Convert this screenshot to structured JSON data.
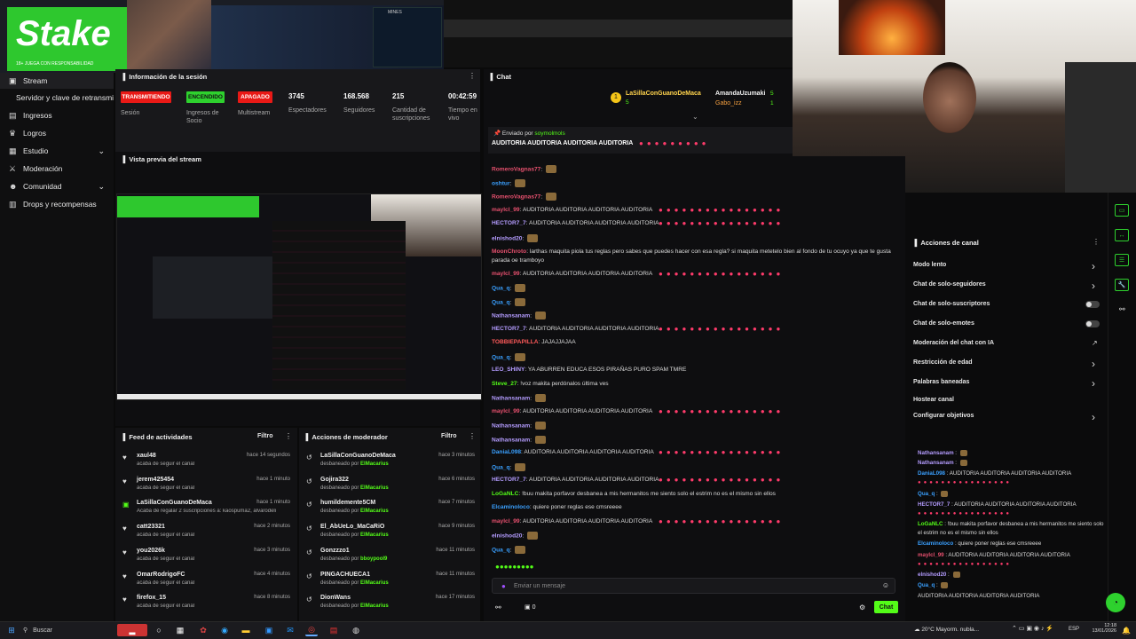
{
  "overlay": {
    "logo": "Stake",
    "logo_sub": "18+ JUEGA CON RESPONSABILIDAD",
    "game_tag": "MINES"
  },
  "session": {
    "title": "Información de la sesión",
    "badges": [
      {
        "label": "TRANSMITIENDO",
        "color": "#e91916",
        "caption": "Sesión"
      },
      {
        "label": "ENCENDIDO",
        "color": "#2ed12e",
        "caption": "Ingresos de Socio"
      },
      {
        "label": "APAGADO",
        "color": "#e91916",
        "caption": "Multistream"
      }
    ],
    "stats": [
      {
        "value": "3745",
        "label": "Espectadores"
      },
      {
        "value": "168.568",
        "label": "Seguidores"
      },
      {
        "value": "215",
        "label": "Cantidad de suscripciones"
      },
      {
        "value": "00:42:59",
        "label": "Tiempo en vivo"
      }
    ]
  },
  "sidebar": {
    "items": [
      {
        "label": "Stream",
        "icon": "stream-icon"
      },
      {
        "label": "Servidor y clave de retransmisión",
        "icon": ""
      },
      {
        "label": "Ingresos",
        "icon": "money-icon"
      },
      {
        "label": "Logros",
        "icon": "trophy-icon"
      },
      {
        "label": "Estudio",
        "icon": "studio-icon"
      },
      {
        "label": "Moderación",
        "icon": "sword-icon"
      },
      {
        "label": "Comunidad",
        "icon": "community-icon"
      },
      {
        "label": "Drops y recompensas",
        "icon": "gift-icon"
      }
    ]
  },
  "preview": {
    "title": "Vista previa del stream"
  },
  "chat": {
    "title": "Chat",
    "top_users": [
      {
        "name": "LaSillaConGuanoDeMaca",
        "count": "5"
      },
      {
        "name": "AmandaUzumaki",
        "count": "5"
      },
      {
        "name": "Gabo_izz",
        "count": "1"
      }
    ],
    "pinned_by_label": "Enviado por",
    "pinned_by_user": "soymolmols",
    "pinned_text": "AUDITORIA AUDITORIA AUDITORIA AUDITORIA",
    "input_placeholder": "Enviar un mensaje",
    "send_label": "Chat",
    "counter": "0",
    "messages": [
      {
        "user": "RomeroVagnas77",
        "color": "#e6506e",
        "text": ""
      },
      {
        "user": "oshtur",
        "color": "#3aa0ff",
        "text": ""
      },
      {
        "user": "RomeroVagnas77",
        "color": "#e6506e",
        "text": ""
      },
      {
        "user": "maylcl_99",
        "color": "#e6506e",
        "text": "AUDITORIA AUDITORIA AUDITORIA AUDITORIA"
      },
      {
        "user": "HECTOR7_7",
        "color": "#b49cff",
        "text": "AUDITORIA AUDITORIA AUDITORIA AUDITORIA"
      },
      {
        "user": "elnishod20",
        "color": "#b49cff",
        "text": ""
      },
      {
        "user": "MoonChroto",
        "color": "#e6506e",
        "text": "larthas maquita piola tus reglas pero sabes que puedes hacer con esa regla? si maquita metetelo bien al fondo de tu ocuyo ya que te gusta parada oe tramboyo"
      },
      {
        "user": "maylcl_99",
        "color": "#e6506e",
        "text": "AUDITORIA AUDITORIA AUDITORIA AUDITORIA"
      },
      {
        "user": "Qua_q",
        "color": "#3aa0ff",
        "text": ""
      },
      {
        "user": "Qua_q",
        "color": "#3aa0ff",
        "text": ""
      },
      {
        "user": "Nathansanam",
        "color": "#b49cff",
        "text": ""
      },
      {
        "user": "HECTOR7_7",
        "color": "#b49cff",
        "text": "AUDITORIA AUDITORIA AUDITORIA AUDITORIA"
      },
      {
        "user": "TOBBIEPAPILLA",
        "color": "#ff5a5a",
        "text": "JAJAJJAJAA"
      },
      {
        "user": "Qua_q",
        "color": "#3aa0ff",
        "text": ""
      },
      {
        "user": "LEO_SHINY",
        "color": "#b49cff",
        "text": "YA ABURREN EDUCA ESOS PIRAÑAS PURO SPAM TMRE"
      },
      {
        "user": "Steve_27",
        "color": "#53fc18",
        "text": "!voz makita perdónalos última ves"
      },
      {
        "user": "Nathansanam",
        "color": "#b49cff",
        "text": ""
      },
      {
        "user": "maylcl_99",
        "color": "#e6506e",
        "text": "AUDITORIA AUDITORIA AUDITORIA AUDITORIA"
      },
      {
        "user": "Nathansanam",
        "color": "#b49cff",
        "text": ""
      },
      {
        "user": "Nathansanam",
        "color": "#b49cff",
        "text": ""
      },
      {
        "user": "DaniaL098",
        "color": "#3aa0ff",
        "text": "AUDITORIA AUDITORIA AUDITORIA AUDITORIA"
      },
      {
        "user": "Qua_q",
        "color": "#3aa0ff",
        "text": ""
      },
      {
        "user": "HECTOR7_7",
        "color": "#b49cff",
        "text": "AUDITORIA AUDITORIA AUDITORIA AUDITORIA"
      },
      {
        "user": "LoGaNLC",
        "color": "#53fc18",
        "text": "!buu makita porfavor desbanea a mis hermanitos me siento solo el estrim no es el mismo sin ellos"
      },
      {
        "user": "Elcaminoloco",
        "color": "#3aa0ff",
        "text": "quiere poner reglas ese cmsreeee"
      },
      {
        "user": "maylcl_99",
        "color": "#e6506e",
        "text": "AUDITORIA AUDITORIA AUDITORIA AUDITORIA"
      },
      {
        "user": "elnishod20",
        "color": "#b49cff",
        "text": ""
      },
      {
        "user": "Qua_q",
        "color": "#3aa0ff",
        "text": ""
      }
    ]
  },
  "activity": {
    "title": "Feed de actividades",
    "filter": "Filtro",
    "items": [
      {
        "name": "xaul48",
        "sub": "acaba de seguir el canal",
        "time": "hace 14 segundos",
        "icon": "heart-icon"
      },
      {
        "name": "jerem425454",
        "sub": "acaba de seguir el canal",
        "time": "hace 1 minuto",
        "icon": "heart-icon"
      },
      {
        "name": "LaSillaConGuanoDeMaca",
        "sub": "Acaba de regalar 2 suscripciones a: kaospuma2, alvarodeli",
        "time": "hace 1 minuto",
        "icon": "gift-icon"
      },
      {
        "name": "catt23321",
        "sub": "acaba de seguir el canal",
        "time": "hace 2 minutos",
        "icon": "heart-icon"
      },
      {
        "name": "you2026k",
        "sub": "acaba de seguir el canal",
        "time": "hace 3 minutos",
        "icon": "heart-icon"
      },
      {
        "name": "OmarRodrigoFC",
        "sub": "acaba de seguir el canal",
        "time": "hace 4 minutos",
        "icon": "heart-icon"
      },
      {
        "name": "firefox_15",
        "sub": "acaba de seguir el canal",
        "time": "hace 8 minutos",
        "icon": "heart-icon"
      }
    ]
  },
  "modactions": {
    "title": "Acciones de moderador",
    "filter": "Filtro",
    "items": [
      {
        "name": "LaSillaConGuanoDeMaca",
        "sub": "desbaneado por",
        "by": "ElMacarius",
        "time": "hace 3 minutos"
      },
      {
        "name": "Gojira322",
        "sub": "desbaneado por",
        "by": "ElMacarius",
        "time": "hace 6 minutos"
      },
      {
        "name": "humildemente5CM",
        "sub": "desbaneado por",
        "by": "ElMacarius",
        "time": "hace 7 minutos"
      },
      {
        "name": "El_AbUeLo_MaCaRiO",
        "sub": "desbaneado por",
        "by": "ElMacarius",
        "time": "hace 9 minutos"
      },
      {
        "name": "Gonzzzo1",
        "sub": "desbaneado por",
        "by": "bboypool9",
        "time": "hace 11 minutos"
      },
      {
        "name": "PINGACHUECA1",
        "sub": "desbaneado por",
        "by": "ElMacarius",
        "time": "hace 11 minutos"
      },
      {
        "name": "DionWans",
        "sub": "desbaneado por",
        "by": "ElMacarius",
        "time": "hace 17 minutos"
      }
    ]
  },
  "channel_actions": {
    "title": "Acciones de canal",
    "items": [
      {
        "label": "Modo lento",
        "control": "chevron"
      },
      {
        "label": "Chat de solo-seguidores",
        "control": "chevron"
      },
      {
        "label": "Chat de solo-suscriptores",
        "control": "toggle"
      },
      {
        "label": "Chat de solo-emotes",
        "control": "toggle"
      },
      {
        "label": "Moderación del chat con IA",
        "control": "external"
      },
      {
        "label": "Restricción de edad",
        "control": "chevron"
      },
      {
        "label": "Palabras baneadas",
        "control": "chevron"
      },
      {
        "label": "Hostear canal",
        "control": "none"
      },
      {
        "label": "Configurar objetivos",
        "control": "chevron"
      }
    ]
  },
  "mini_chat": [
    {
      "user": "Nathansanam",
      "color": "#b49cff",
      "text": ""
    },
    {
      "user": "Nathansanam",
      "color": "#b49cff",
      "text": ""
    },
    {
      "user": "DaniaL098",
      "color": "#3aa0ff",
      "text": "AUDITORIA AUDITORIA AUDITORIA AUDITORIA"
    },
    {
      "user": "Qua_q",
      "color": "#3aa0ff",
      "text": ""
    },
    {
      "user": "HECTOR7_7",
      "color": "#b49cff",
      "text": "AUDITORIA AUDITORIA AUDITORIA AUDITORIA"
    },
    {
      "user": "LoGaNLC",
      "color": "#53fc18",
      "text": "!buu makita porfavor desbanea a mis hermanitos me siento solo"
    },
    {
      "user": "",
      "color": "#ddd",
      "text": "el estrim no es el mismo sin ellos"
    },
    {
      "user": "Elcaminoloco",
      "color": "#3aa0ff",
      "text": "quiere poner reglas ese cmsreeee"
    },
    {
      "user": "maylcl_99",
      "color": "#e6506e",
      "text": "AUDITORIA AUDITORIA AUDITORIA AUDITORIA"
    },
    {
      "user": "elnishod20",
      "color": "#b49cff",
      "text": ""
    },
    {
      "user": "Qua_q",
      "color": "#3aa0ff",
      "text": ""
    },
    {
      "user": "",
      "color": "#ddd",
      "text": "AUDITORIA AUDITORIA AUDITORIA AUDITORIA"
    }
  ],
  "taskbar": {
    "search": "Buscar",
    "weather": "20°C Mayorm. nubla...",
    "lang": "ESP",
    "time": "12:18",
    "date": "13/01/2026"
  },
  "colors": {
    "accent": "#53fc18",
    "live": "#e91916",
    "panel": "#18181b"
  }
}
